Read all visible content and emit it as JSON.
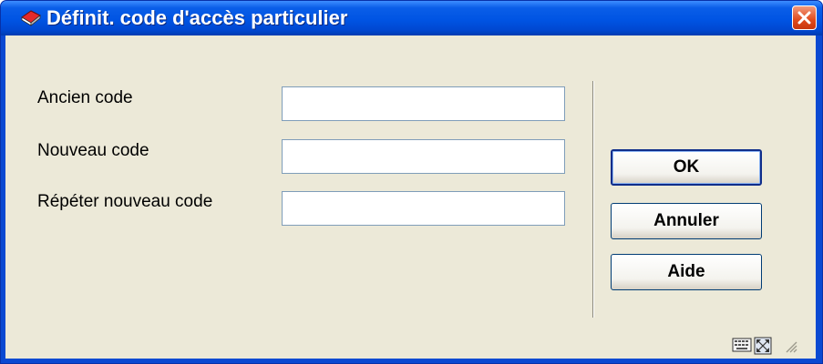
{
  "window": {
    "title": "Définit. code d'accès particulier"
  },
  "form": {
    "old_code": {
      "label": "Ancien code",
      "value": ""
    },
    "new_code": {
      "label": "Nouveau code",
      "value": ""
    },
    "repeat_code": {
      "label": "Répéter nouveau code",
      "value": ""
    }
  },
  "buttons": {
    "ok": "OK",
    "cancel": "Annuler",
    "help": "Aide"
  },
  "icons": {
    "app": "book-icon",
    "close": "close-icon",
    "status_left": "keyboard-icon",
    "status_right": "resize-icon"
  },
  "colors": {
    "titlebar": "#0054e3",
    "close_button": "#e04a1c",
    "window_body": "#ece9d8"
  }
}
